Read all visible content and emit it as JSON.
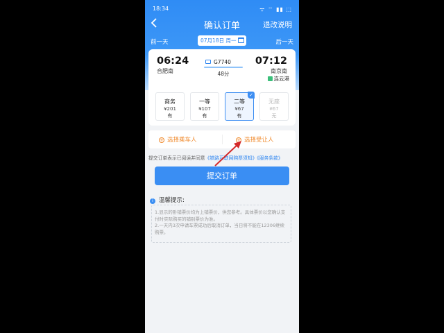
{
  "status_bar": {
    "time": "18:34",
    "icons_text": "ᯤ ⌔ ▮▮ ⬚"
  },
  "titlebar": {
    "back_icon": "chevron-left-icon",
    "title": "确认订单",
    "refund_link": "退改说明"
  },
  "day_nav": {
    "prev": "前一天",
    "date": "07月18日 周一",
    "next": "后一天"
  },
  "trip": {
    "depart_time": "06:24",
    "depart_station": "合肥南",
    "train_no": "G7740",
    "duration": "48分",
    "arrive_time": "07:12",
    "arrive_station": "南京南",
    "via_station": "连云港"
  },
  "seats": [
    {
      "name": "商务",
      "price": "¥201",
      "availability": "有",
      "state": "normal"
    },
    {
      "name": "一等",
      "price": "¥107",
      "availability": "有",
      "state": "normal"
    },
    {
      "name": "二等",
      "price": "¥67",
      "availability": "有",
      "state": "selected"
    },
    {
      "name": "无座",
      "price": "¥67",
      "availability": "无",
      "state": "disabled"
    }
  ],
  "passenger_actions": {
    "select_passenger": "选择乘车人",
    "select_recipient": "选择受让人"
  },
  "agreement": {
    "prefix": "提交订单表示已阅读并同意",
    "link1": "《铁路互联网购票须知》",
    "link2": "《服务条款》"
  },
  "submit_label": "提交订单",
  "tips": {
    "heading": "温馨提示:",
    "line1": "1.显示的卧铺票价均为上铺票价，供您参考。具体票价以您确认支付时实际购买的铺别票价为准。",
    "line2": "2.一天内3次申请车票成功后取消订单，当日将不能在12306继续购票。"
  },
  "colors": {
    "primary": "#3a8ef3",
    "accent_orange": "#f08a2d",
    "annotation_red": "#d42a2a"
  }
}
